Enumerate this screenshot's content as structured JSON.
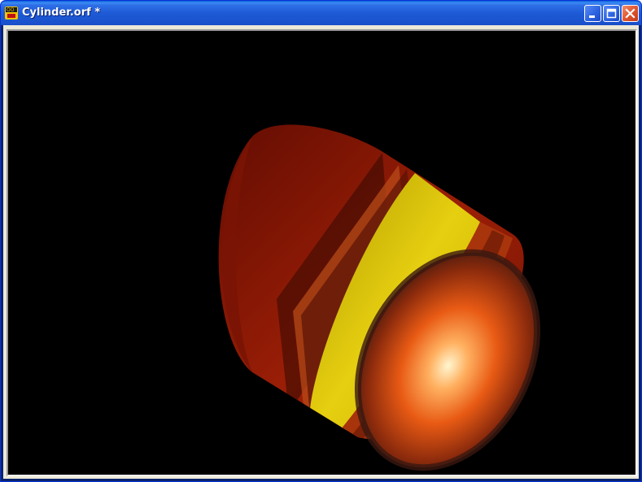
{
  "window": {
    "title": "Cylinder.orf *",
    "app_icon": "app-logo-icon",
    "controls": {
      "minimize_icon": "minimize-icon",
      "maximize_icon": "maximize-icon",
      "close_icon": "close-icon"
    }
  },
  "viewport": {
    "background": "#000000",
    "object": "cylinder",
    "colors": {
      "band_red": "#8a1a05",
      "band_orange": "#b83a10",
      "band_yellow": "#d8c200",
      "core_hot": "#fff4c0",
      "core_orange": "#f07820",
      "rim_dark": "#3a1810"
    }
  }
}
